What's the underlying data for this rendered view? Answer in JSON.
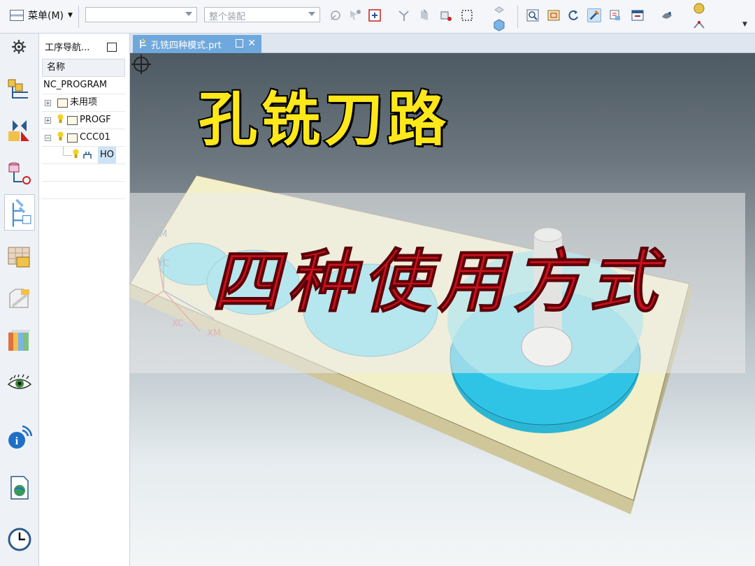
{
  "toolbar": {
    "menu_label": "菜单(M)",
    "combo1_value": "",
    "combo2_value": "整个装配"
  },
  "navigator": {
    "title": "工序导航...",
    "column_name": "名称",
    "root": "NC_PROGRAM",
    "items": [
      {
        "label": "未用项"
      },
      {
        "label": "PROGF"
      },
      {
        "label": "CCC01"
      },
      {
        "label": "HO"
      }
    ]
  },
  "tab": {
    "filename": "孔铣四种模式.prt"
  },
  "overlay": {
    "title": "孔铣刀路",
    "subtitle": "四种使用方式"
  },
  "axes": {
    "ym": "YM",
    "yc": "YC",
    "xc": "XC",
    "xm": "XM"
  },
  "colors": {
    "title_yellow": "#ffe81a",
    "subtitle_red": "#c8121b",
    "part_face": "#f3efc8",
    "hole_cyan": "#79e3f1"
  }
}
